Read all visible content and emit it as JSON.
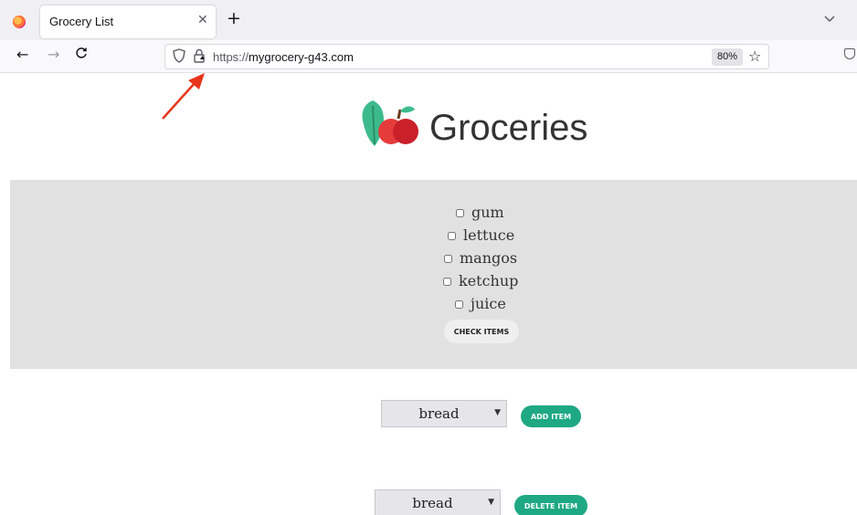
{
  "browser": {
    "tab_title": "Grocery List",
    "url_scheme": "https://",
    "url_host": "mygrocery-g43.com",
    "zoom": "80%"
  },
  "icons": {
    "tab_close": "close-icon",
    "new_tab": "plus-icon",
    "back": "arrow-left-icon",
    "forward": "arrow-right-icon",
    "reload": "reload-icon",
    "bookmark": "star-icon",
    "annotation": "red-arrow-icon"
  },
  "page": {
    "brand": "Groceries",
    "items": [
      {
        "label": "gum",
        "checked": false
      },
      {
        "label": "lettuce",
        "checked": false
      },
      {
        "label": "mangos",
        "checked": false
      },
      {
        "label": "ketchup",
        "checked": false
      },
      {
        "label": "juice",
        "checked": false
      }
    ],
    "check_button": "CHECK ITEMS",
    "add_select_value": "bread",
    "add_button": "ADD ITEM",
    "delete_select_value": "bread",
    "delete_button": "DELETE ITEM"
  },
  "colors": {
    "accent": "#1fa884",
    "panel": "#e1e1e1",
    "annotation": "#e8341c"
  }
}
